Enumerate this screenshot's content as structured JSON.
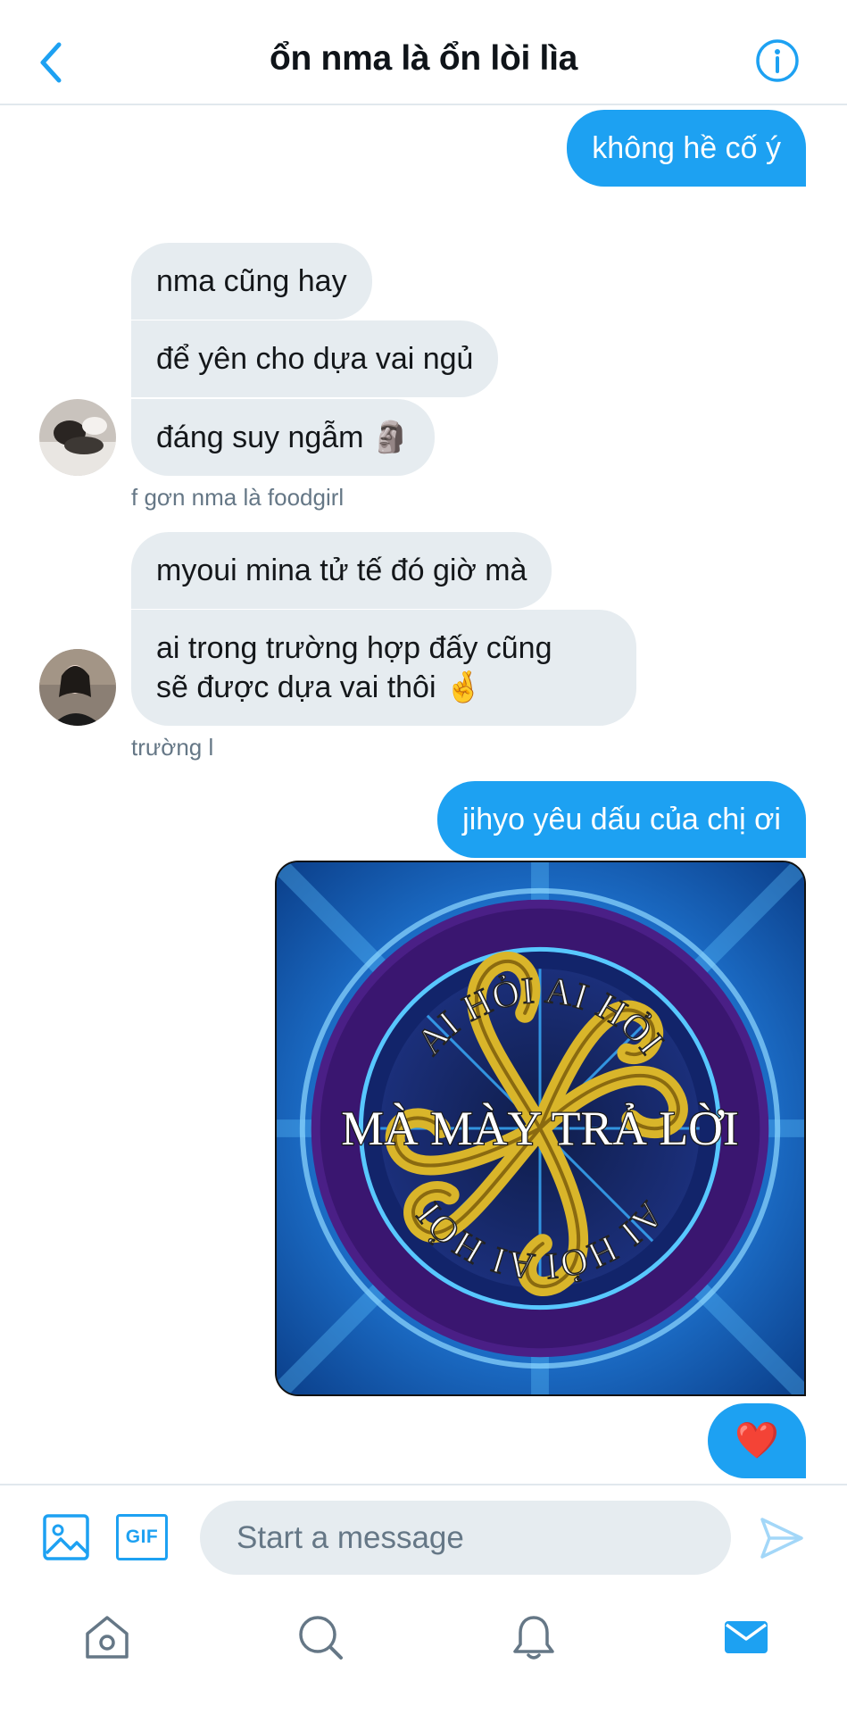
{
  "header": {
    "title": "ổn nma là ổn lòi lìa",
    "back_icon": "chevron-left-icon",
    "info_icon": "info-icon"
  },
  "messages": [
    {
      "id": "m1",
      "direction": "out",
      "text": "không hề cố ý"
    },
    {
      "id": "m2",
      "direction": "in",
      "text": "nma cũng hay"
    },
    {
      "id": "m3",
      "direction": "in",
      "text": "để yên cho dựa vai ngủ"
    },
    {
      "id": "m4",
      "direction": "in",
      "text": "đáng suy ngẫm 🗿"
    },
    {
      "id": "m5",
      "direction": "in",
      "text": "myoui mina tử tế đó giờ mà"
    },
    {
      "id": "m6",
      "direction": "in",
      "line1": "ai trong trường hợp đấy cũng",
      "line2": "sẽ được dựa vai thôi 🤞"
    },
    {
      "id": "m7",
      "direction": "out",
      "text": "jihyo yêu dấu của chị ơi"
    },
    {
      "id": "m8",
      "direction": "out",
      "text": "❤️"
    }
  ],
  "senders": {
    "first": "f gơn nma là foodgirl",
    "second": "trường l"
  },
  "meme": {
    "top_text": "AI HỎI AI HỎI",
    "middle_text": "MÀ MÀY TRẢ LỜI",
    "bottom_text": "AI HỎI AI HỎI"
  },
  "composer": {
    "placeholder": "Start a message",
    "gif_label": "GIF",
    "image_icon": "image-icon",
    "send_icon": "send-icon"
  },
  "nav": {
    "items": [
      "home-icon",
      "search-icon",
      "notifications-icon",
      "messages-icon"
    ],
    "active": "messages-icon"
  },
  "colors": {
    "accent": "#1da1f2",
    "incoming_bubble": "#e6ecf0",
    "muted_text": "#657786"
  }
}
